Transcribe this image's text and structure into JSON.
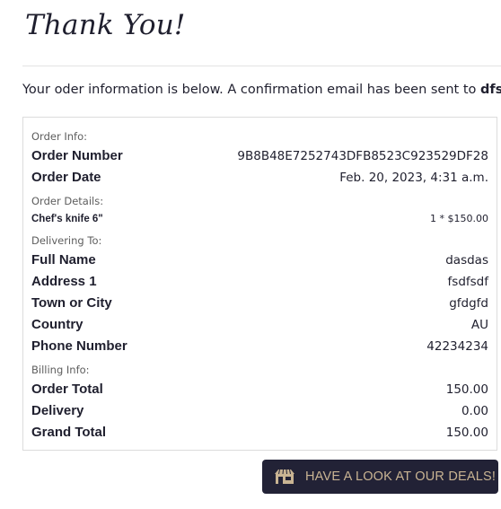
{
  "header": {
    "title": "Thank You!"
  },
  "intro": {
    "text": "Your oder information is below. A confirmation email has been sent to ",
    "email": "dfsdfsd@"
  },
  "order_info": {
    "section_label": "Order Info:",
    "order_number_label": "Order Number",
    "order_number_value": "9B8B48E7252743DFB8523C923529DF28",
    "order_date_label": "Order Date",
    "order_date_value": "Feb. 20, 2023, 4:31 a.m."
  },
  "order_details": {
    "section_label": "Order Details:",
    "items": [
      {
        "name": "Chef's knife 6\"",
        "qty_price": "1 * $150.00"
      }
    ]
  },
  "delivering_to": {
    "section_label": "Delivering To:",
    "fields": [
      {
        "label": "Full Name",
        "value": "dasdas"
      },
      {
        "label": "Address 1",
        "value": "fsdfsdf"
      },
      {
        "label": "Town or City",
        "value": "gfdgfd"
      },
      {
        "label": "Country",
        "value": "AU"
      },
      {
        "label": "Phone Number",
        "value": "42234234"
      }
    ]
  },
  "billing_info": {
    "section_label": "Billing Info:",
    "fields": [
      {
        "label": "Order Total",
        "value": "150.00"
      },
      {
        "label": "Delivery",
        "value": "0.00"
      },
      {
        "label": "Grand Total",
        "value": "150.00"
      }
    ]
  },
  "deals_button": {
    "label": "HAVE A LOOK AT OUR DEALS!",
    "icon": "store-icon",
    "background": "#222236",
    "text_color": "#c9b493"
  }
}
